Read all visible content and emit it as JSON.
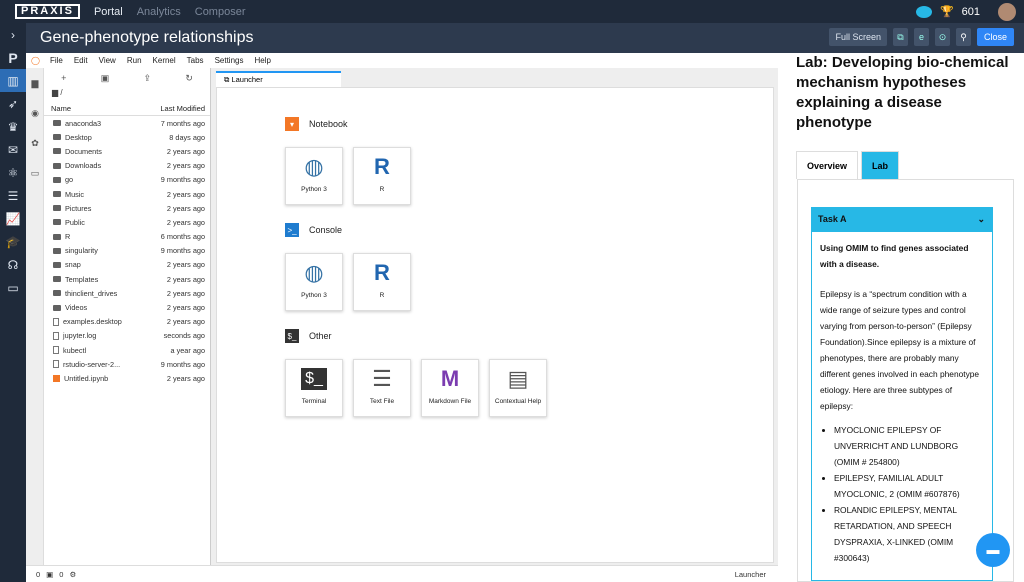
{
  "topbar": {
    "logo": "PRAXIS",
    "nav": [
      "Portal",
      "Analytics",
      "Composer"
    ],
    "score": "601"
  },
  "app": {
    "title": "Gene-phenotype relationships",
    "fullscreen": "Full Screen",
    "close": "Close"
  },
  "jupyter": {
    "menu": [
      "File",
      "Edit",
      "View",
      "Run",
      "Kernel",
      "Tabs",
      "Settings",
      "Help"
    ],
    "path": "/",
    "col_name": "Name",
    "col_modified": "Last Modified",
    "files": [
      {
        "name": "anaconda3",
        "modified": "7 months ago",
        "type": "folder"
      },
      {
        "name": "Desktop",
        "modified": "8 days ago",
        "type": "folder"
      },
      {
        "name": "Documents",
        "modified": "2 years ago",
        "type": "folder"
      },
      {
        "name": "Downloads",
        "modified": "2 years ago",
        "type": "folder"
      },
      {
        "name": "go",
        "modified": "9 months ago",
        "type": "folder"
      },
      {
        "name": "Music",
        "modified": "2 years ago",
        "type": "folder"
      },
      {
        "name": "Pictures",
        "modified": "2 years ago",
        "type": "folder"
      },
      {
        "name": "Public",
        "modified": "2 years ago",
        "type": "folder"
      },
      {
        "name": "R",
        "modified": "6 months ago",
        "type": "folder"
      },
      {
        "name": "singularity",
        "modified": "9 months ago",
        "type": "folder"
      },
      {
        "name": "snap",
        "modified": "2 years ago",
        "type": "folder"
      },
      {
        "name": "Templates",
        "modified": "2 years ago",
        "type": "folder"
      },
      {
        "name": "thinclient_drives",
        "modified": "2 years ago",
        "type": "folder"
      },
      {
        "name": "Videos",
        "modified": "2 years ago",
        "type": "folder"
      },
      {
        "name": "examples.desktop",
        "modified": "2 years ago",
        "type": "file"
      },
      {
        "name": "jupyter.log",
        "modified": "seconds ago",
        "type": "file"
      },
      {
        "name": "kubectl",
        "modified": "a year ago",
        "type": "file"
      },
      {
        "name": "rstudio-server-2...",
        "modified": "9 months ago",
        "type": "file"
      },
      {
        "name": "Untitled.ipynb",
        "modified": "2 years ago",
        "type": "notebook"
      }
    ],
    "tab": "Launcher",
    "sections": {
      "notebook": "Notebook",
      "console": "Console",
      "other": "Other"
    },
    "cards": {
      "python3": "Python 3",
      "r": "R",
      "terminal": "Terminal",
      "textfile": "Text File",
      "markdown": "Markdown File",
      "contextual": "Contextual Help"
    },
    "status": {
      "a": "0",
      "b": "0",
      "mode": "Launcher"
    }
  },
  "lab": {
    "title": "Lab: Developing bio-chemical mechanism hypotheses explaining a disease phenotype",
    "tabs": [
      "Overview",
      "Lab"
    ],
    "task": "Task A",
    "heading": "Using OMIM to find genes associated with a disease.",
    "para": "Epilepsy is a “spectrum condition with a wide range of seizure types and control varying from person-to-person” (Epilepsy Foundation).Since epilepsy is a mixture of phenotypes, there are probably many different genes involved in each phenotype etiology. Here are three subtypes of epilepsy:",
    "items": [
      "MYOCLONIC EPILEPSY OF UNVERRICHT AND LUNDBORG (OMIM # 254800)",
      "EPILEPSY, FAMILIAL ADULT MYOCLONIC, 2 (OMIM #607876)",
      "ROLANDIC EPILEPSY, MENTAL RETARDATION, AND SPEECH DYSPRAXIA, X-LINKED (OMIM #300643)"
    ]
  }
}
